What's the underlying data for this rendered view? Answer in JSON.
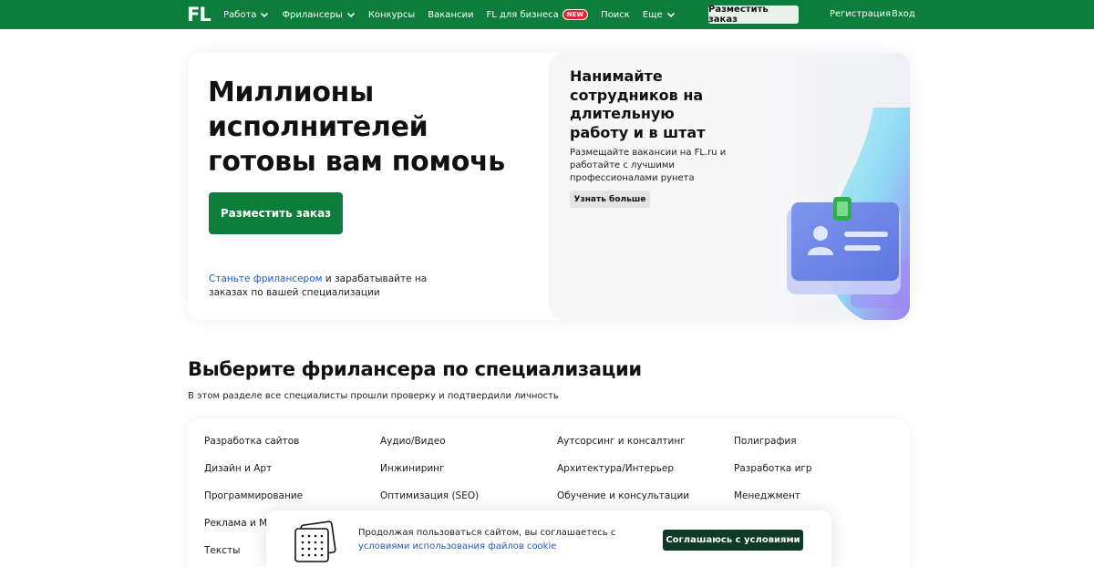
{
  "header": {
    "logo": "FL",
    "nav": [
      {
        "label": "Работа",
        "dropdown": true
      },
      {
        "label": "Фрилансеры",
        "dropdown": true
      },
      {
        "label": "Конкурсы",
        "dropdown": false
      },
      {
        "label": "Вакансии",
        "dropdown": false
      },
      {
        "label": "FL для бизнеса",
        "badge": "NEW"
      },
      {
        "label": "Поиск",
        "dropdown": false
      },
      {
        "label": "Еще",
        "dropdown": true
      }
    ],
    "post_order_button": "Разместить заказ",
    "register_link": "Регистрация",
    "login_link": "Вход"
  },
  "hero": {
    "title": "Миллионы исполнителей готовы вам помочь",
    "post_order_button": "Разместить заказ",
    "become_link": "Станьте фрилансером",
    "become_text": " и зарабатывайте на заказах по вашей специализации",
    "promo_title": "Нанимайте сотрудников на длительную работу и в штат",
    "promo_text": "Размещайте вакансии на FL.ru и работайте с лучшими профессионалами рунета",
    "promo_button": "Узнать больше"
  },
  "specializations": {
    "title": "Выберите фрилансера по специализации",
    "subtitle": "В этом разделе все специалисты прошли проверку и подтвердили личность",
    "columns": [
      [
        "Разработка сайтов",
        "Дизайн и Арт",
        "Программирование",
        "Реклама и Маркетинг",
        "Тексты"
      ],
      [
        "Аудио/Видео",
        "Инжиниринг",
        "Оптимизация (SEO)"
      ],
      [
        "Аутсорсинг и консалтинг",
        "Архитектура/Интерьер",
        "Обучение и консультации"
      ],
      [
        "Полиграфия",
        "Разработка игр",
        "Менеджмент"
      ]
    ]
  },
  "cookie": {
    "text": "Продолжая пользоваться сайтом, вы соглашаетесь с",
    "link": "условиями использования файлов cookie",
    "button": "Соглашаюсь с условиями"
  },
  "colors": {
    "brand": "#0c7d3b",
    "link": "#1f58c8",
    "cookie_button": "#0f3b26",
    "badge": "#e3242b"
  }
}
